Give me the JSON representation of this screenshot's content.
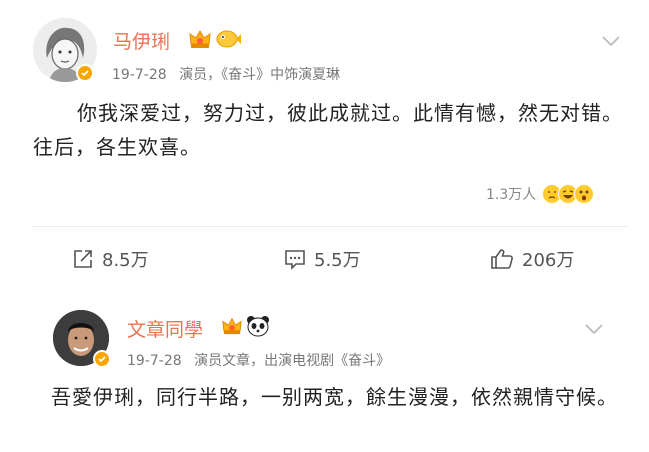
{
  "post1": {
    "author": "马伊琍",
    "date": "19-7-28",
    "source": "演员，《奋斗》中饰演夏琳",
    "body": "你我深爱过，努力过，彼此成就过。此情有憾，然无对错。往后，各生欢喜。",
    "reactions_count": "1.3万人",
    "actions": {
      "share": "8.5万",
      "comment": "5.5万",
      "like": "206万"
    },
    "colors": {
      "name": "#eb7350",
      "verified": "#f7a600"
    },
    "icons": [
      "crown-badge-icon",
      "fish-badge-icon",
      "verified-icon",
      "chevron-down-icon"
    ]
  },
  "post2": {
    "author": "文章同學",
    "date": "19-7-28",
    "source": "演员文章，出演电视剧《奋斗》",
    "body": "吾愛伊琍，同行半路，一别两宽，餘生漫漫，依然親情守候。",
    "icons": [
      "crown-badge-icon",
      "panda-badge-icon",
      "verified-icon",
      "chevron-down-icon"
    ]
  }
}
